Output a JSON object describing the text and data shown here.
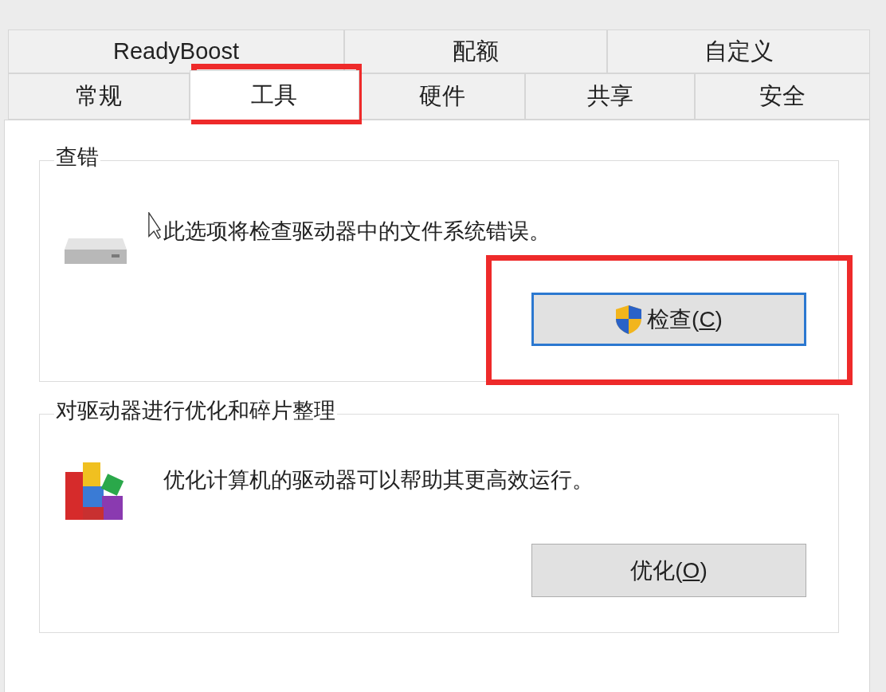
{
  "tabs_row_1": [
    {
      "label": "ReadyBoost",
      "selected": false
    },
    {
      "label": "配额",
      "selected": false
    },
    {
      "label": "自定义",
      "selected": false
    }
  ],
  "tabs_row_2": [
    {
      "label": "常规",
      "selected": false
    },
    {
      "label": "工具",
      "selected": true
    },
    {
      "label": "硬件",
      "selected": false
    },
    {
      "label": "共享",
      "selected": false
    },
    {
      "label": "安全",
      "selected": false
    }
  ],
  "groups": [
    {
      "title": "查错",
      "kind": "check",
      "description": "此选项将检查驱动器中的文件系统错误。",
      "button": {
        "label_before": "检查(",
        "accelerator": "C",
        "label_after": ")",
        "focused": true,
        "shield": true
      }
    },
    {
      "title": "对驱动器进行优化和碎片整理",
      "kind": "optimize",
      "description": "优化计算机的驱动器可以帮助其更高效运行。",
      "button": {
        "label_before": "优化(",
        "accelerator": "O",
        "label_after": ")",
        "focused": false,
        "shield": false
      }
    }
  ]
}
